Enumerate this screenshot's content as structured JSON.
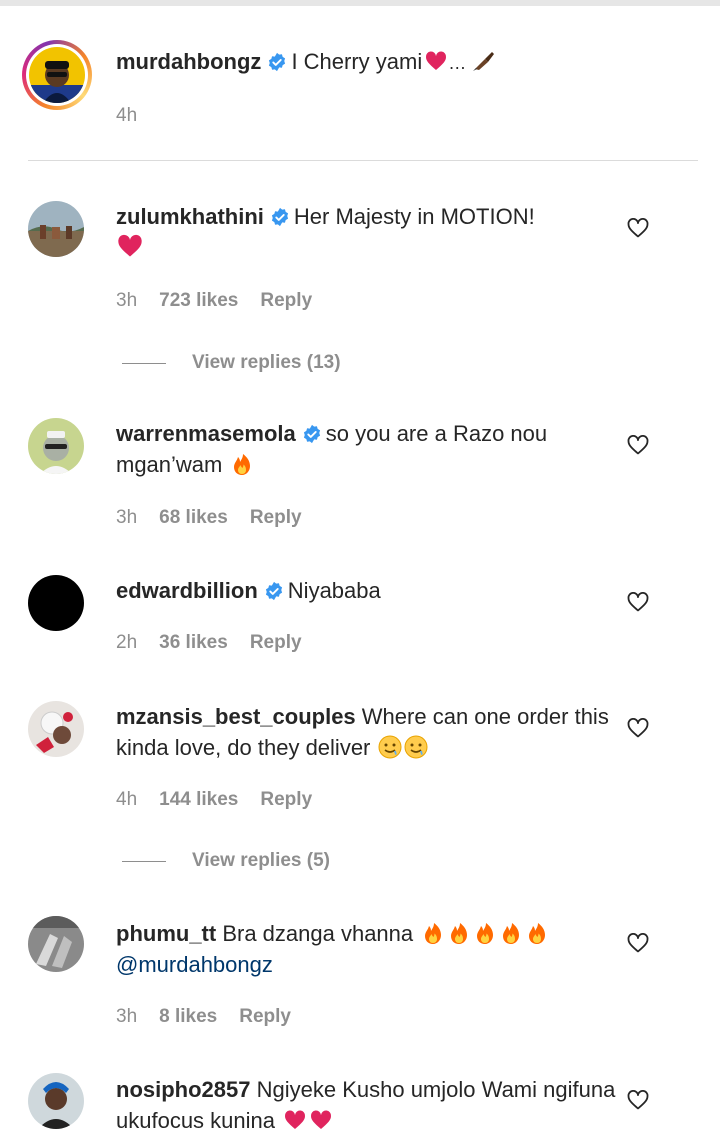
{
  "caption": {
    "username": "murdahbongz",
    "text": "I Cherry yami",
    "emojis": [
      "red-heart",
      "ellipsis",
      "writing-hand"
    ],
    "time": "4h"
  },
  "comments": [
    {
      "username": "zulumkhathini",
      "text": "Her Majesty in MOTION!",
      "time": "3h",
      "likes": "723 likes",
      "reply": "Reply",
      "view_replies": "View replies (13)"
    },
    {
      "username": "warrenmasemola",
      "text": "so you are a Razo nou mgan’wam",
      "time": "3h",
      "likes": "68 likes",
      "reply": "Reply"
    },
    {
      "username": "edwardbillion",
      "text": "Niyababa",
      "time": "2h",
      "likes": "36 likes",
      "reply": "Reply"
    },
    {
      "username": "mzansis_best_couples",
      "text": "Where can one order this kinda love, do they deliver",
      "time": "4h",
      "likes": "144 likes",
      "reply": "Reply",
      "view_replies": "View replies (5)"
    },
    {
      "username": "phumu_tt",
      "text": "Bra dzanga vhanna",
      "mention": "@murdahbongz",
      "time": "3h",
      "likes": "8 likes",
      "reply": "Reply"
    },
    {
      "username": "nosipho2857",
      "text": "Ngiyeke Kusho umjolo Wami ngifuna ukufocus kunina"
    }
  ],
  "icons": {
    "verified": "verified-badge-icon",
    "like": "heart-outline-icon"
  },
  "colors": {
    "verified": "#3897f0",
    "meta": "#8e8e8e",
    "mention": "#00376b",
    "fire": "#ff6a00",
    "heart": "#e0245e"
  }
}
